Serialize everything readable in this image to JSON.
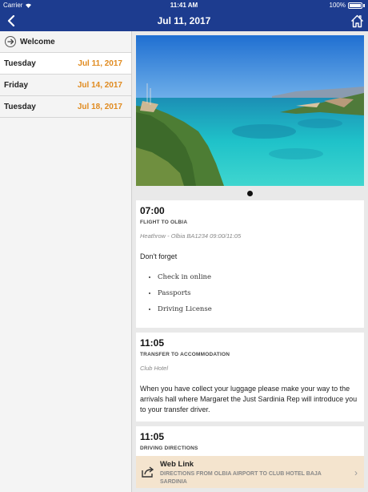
{
  "status": {
    "carrier": "Carrier",
    "time": "11:41 AM",
    "battery": "100%"
  },
  "nav": {
    "title": "Jul 11, 2017"
  },
  "sidebar": {
    "welcome": "Welcome",
    "days": [
      {
        "name": "Tuesday",
        "date": "Jul 11, 2017",
        "active": true
      },
      {
        "name": "Friday",
        "date": "Jul 14, 2017",
        "active": false
      },
      {
        "name": "Tuesday",
        "date": "Jul 18, 2017",
        "active": false
      }
    ]
  },
  "carousel": {
    "current_page": 1,
    "page_count": 1
  },
  "events": [
    {
      "time": "07:00",
      "type": "FLIGHT TO OLBIA",
      "subtitle": "Heathrow - Olbia BA1234 09:00/11:05",
      "text": "Don't forget",
      "list": [
        "Check in online",
        "Passports",
        "Driving License"
      ]
    },
    {
      "time": "11:05",
      "type": "TRANSFER TO ACCOMMODATION",
      "subtitle": "Club Hotel",
      "text": "When you have collect your luggage please make your way to the arrivals hall where Margaret the Just Sardinia Rep will introduce you to your transfer driver."
    },
    {
      "time": "11:05",
      "type": "DRIVING DIRECTIONS",
      "weblink": {
        "title": "Web Link",
        "description": "DIRECTIONS FROM OLBIA AIRPORT TO CLUB HOTEL BAJA SARDINIA"
      }
    }
  ],
  "colors": {
    "nav_bg": "#1d3c8f",
    "date_accent": "#e08a1e",
    "weblink_bg": "#f4e4ce"
  }
}
